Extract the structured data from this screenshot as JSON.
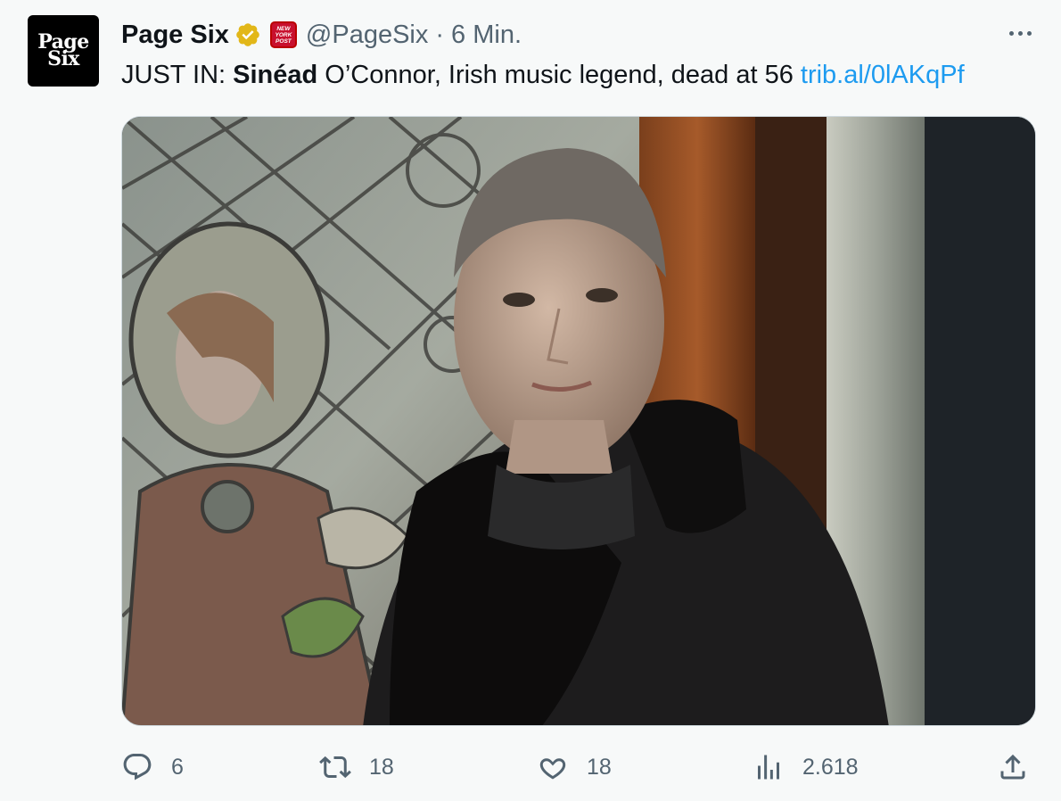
{
  "account": {
    "avatar_line1": "Page",
    "avatar_line2": "Six",
    "name": "Page Six",
    "affiliate_badge_line1": "NEW",
    "affiliate_badge_line2": "YORK",
    "affiliate_badge_line3": "POST",
    "handle": "@PageSix",
    "separator": "·",
    "time": "6 Min."
  },
  "tweet": {
    "prefix": "JUST IN: ",
    "bold": "Sinéad",
    "rest": " O’Connor, Irish music legend, dead at 56 ",
    "link": "trib.al/0lAKqPf"
  },
  "media": {
    "description_icon": "photo-of-woman-with-shaved-head-in-front-of-stained-glass"
  },
  "actions": {
    "replies": "6",
    "retweets": "18",
    "likes": "18",
    "views": "2.618"
  },
  "colors": {
    "link": "#1d9bf0",
    "secondary": "#536471",
    "verified_gold": "#e2b719"
  }
}
